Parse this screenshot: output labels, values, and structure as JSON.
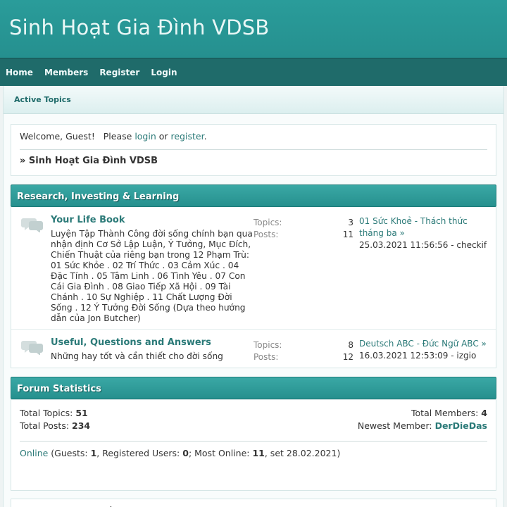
{
  "site": {
    "title": "Sinh Hoạt Gia Đình VDSB"
  },
  "nav": [
    "Home",
    "Members",
    "Register",
    "Login"
  ],
  "tab": "Active Topics",
  "welcome": {
    "prefix": "Welcome, Guest!   Please ",
    "login": "login",
    "or": " or ",
    "register": "register",
    "suffix": "."
  },
  "breadcrumb": "» Sinh Hoạt Gia Đình VDSB",
  "category": "Research, Investing & Learning",
  "labels": {
    "topics": "Topics:",
    "posts": "Posts:"
  },
  "forums": [
    {
      "name": "Your Life Book",
      "desc": "Luyện Tập Thành Công đời sống chính bạn qua nhận định Cơ Sở Lập Luận, Ý Tưởng, Mục Đích, Chiến Thuật của riêng bạn trong 12 Phạm Trù: 01 Sức Khỏe . 02 Trí Thức . 03 Cảm Xúc . 04 Đặc Tính . 05 Tâm Linh . 06 Tình Yêu . 07 Con Cái Gia Đình . 08 Giao Tiếp Xã Hội . 09 Tài Chánh . 10 Sự Nghiệp . 11 Chất Lượng Đời Sống . 12 Ý Tưởng Đời Sống (Dựa theo hướng dẫn của Jon Butcher)",
      "topics": "3",
      "posts": "11",
      "last_topic": "01 Sức Khoẻ - Thách thức tháng ba »",
      "last_meta": "25.03.2021 11:56:56 - checkif"
    },
    {
      "name": "Useful, Questions and Answers",
      "desc": "Những hay tốt và cần thiết cho đời sống",
      "topics": "8",
      "posts": "12",
      "last_topic": "Deutsch ABC - Đức Ngữ ABC »",
      "last_meta": "16.03.2021 12:53:09 - izgio"
    }
  ],
  "stats": {
    "title": "Forum Statistics",
    "total_topics_label": "Total Topics: ",
    "total_topics": "51",
    "total_posts_label": "Total Posts: ",
    "total_posts": "234",
    "total_members_label": "Total Members: ",
    "total_members": "4",
    "newest_label": "Newest Member: ",
    "newest": "DerDieDas",
    "online_link": "Online",
    "guests_label": " (Guests: ",
    "guests": "1",
    "reg_label": ", Registered Users: ",
    "registered": "0",
    "most_label": "; Most Online: ",
    "most": "11",
    "most_date": ", set 28.02.2021)"
  },
  "footer_breadcrumb": "» Sinh Hoạt Gia Đình VDSB",
  "colors": {
    "header": "#2a9c9a",
    "navbar": "#1f6b6a",
    "link": "#2b7a78"
  },
  "icons": {
    "forum": "speech-bubbles-icon"
  }
}
